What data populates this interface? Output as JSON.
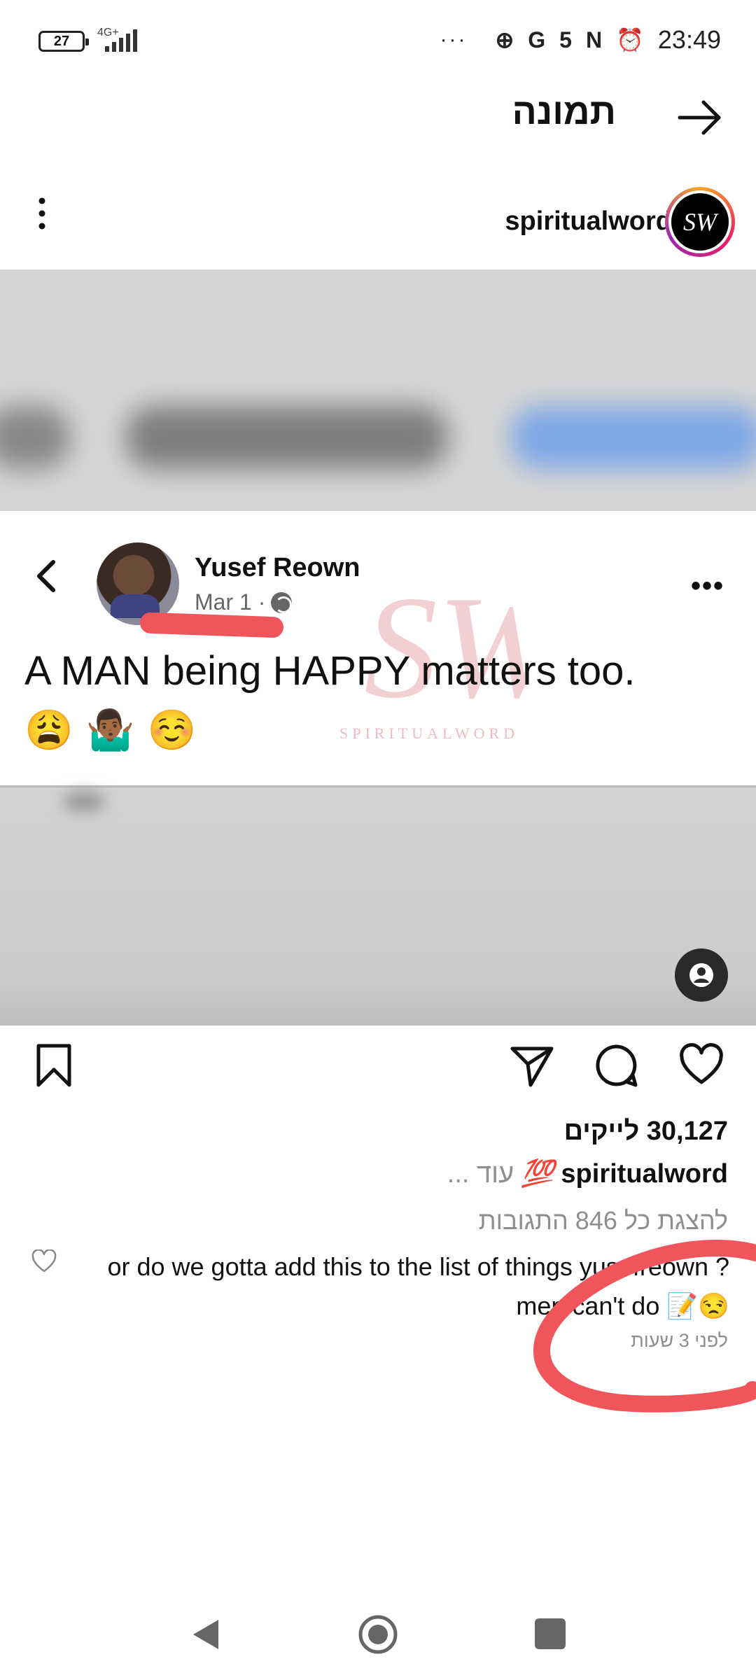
{
  "status_bar": {
    "battery": "27",
    "network": "4G+",
    "overflow": "···",
    "icons": [
      "basketball-icon",
      "google-icon",
      "sync-icon",
      "nfc-icon",
      "alarm-icon"
    ],
    "time": "23:49"
  },
  "header": {
    "title": "תמונה",
    "back_icon": "arrow-right-icon"
  },
  "post": {
    "owner_username": "spiritualword",
    "avatar_initials": "SW",
    "image": {
      "author_name": "Yusef Reown",
      "date": "Mar 1 ·",
      "text": "A MAN being HAPPY matters too.",
      "emojis": [
        "😩",
        "🤷🏾‍♂️",
        "☺️"
      ],
      "watermark": "SPIRITUALWORD",
      "watermark_initials": "SW"
    },
    "likes": "30,127 לייקים",
    "caption": {
      "username": "spiritualword",
      "emoji": "💯",
      "more": "... עוד"
    },
    "view_comments": "להצגת כל 846 התגובות",
    "comment": {
      "text": "or do we gotta add this to the list of things yusefreown ?men can't do 📝😒",
      "time": "לפני 3 שעות"
    }
  },
  "colors": {
    "accent_annotation": "#f0555c",
    "muted_text": "#8e8e8e"
  }
}
